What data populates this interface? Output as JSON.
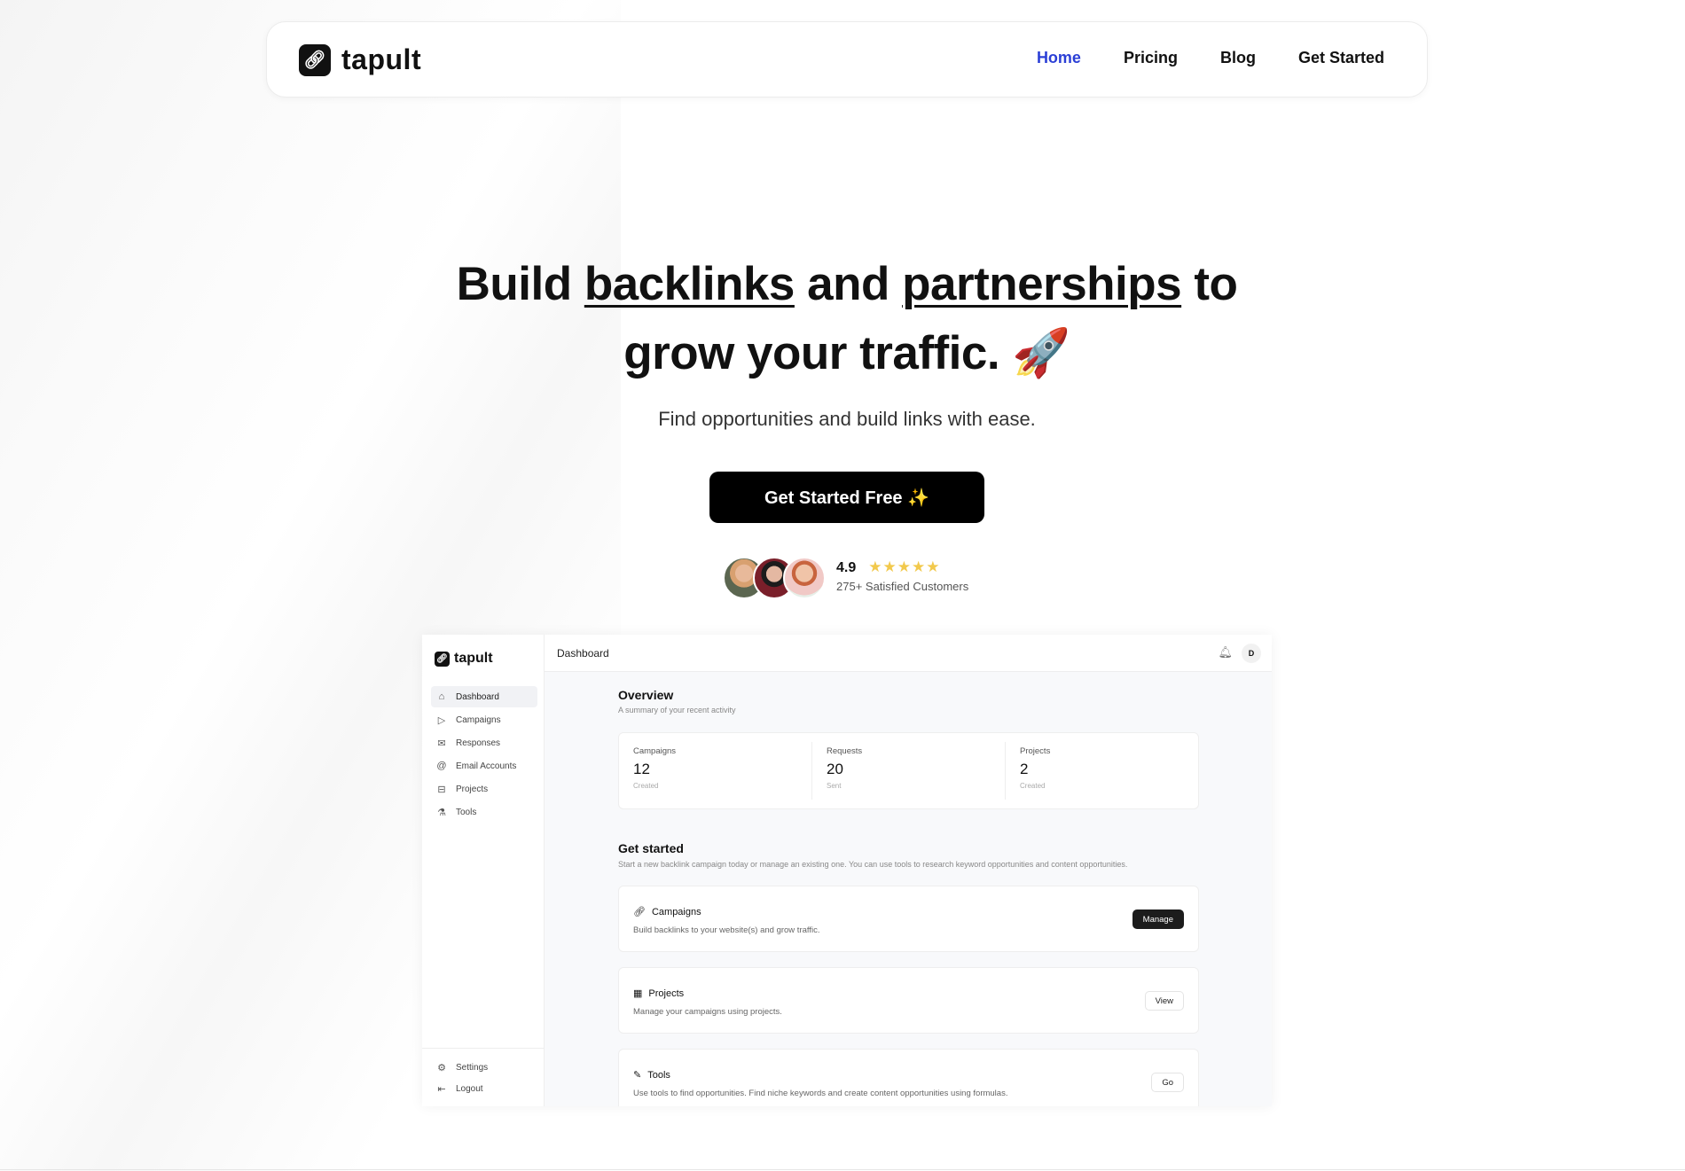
{
  "nav": {
    "brand": "tapult",
    "links": [
      {
        "label": "Home",
        "active": true
      },
      {
        "label": "Pricing"
      },
      {
        "label": "Blog"
      },
      {
        "label": "Get Started"
      }
    ],
    "active_color": "#2b3fd6"
  },
  "hero": {
    "line1_pre": "Build ",
    "word1": "backlinks",
    "line1_mid": " and ",
    "word2": "partnerships",
    "line1_post": " to",
    "line2": "grow your traffic. 🚀",
    "subtitle": "Find opportunities and build links with ease.",
    "cta": "Get Started Free ✨"
  },
  "social_proof": {
    "rating": "4.9",
    "stars": 5,
    "customers": "275+ Satisfied Customers",
    "star_color": "#f2c94c"
  },
  "dashboard": {
    "brand": "tapult",
    "header_title": "Dashboard",
    "avatar_letter": "D",
    "sidebar": [
      {
        "label": "Dashboard",
        "icon": "home-icon",
        "active": true
      },
      {
        "label": "Campaigns",
        "icon": "send-icon"
      },
      {
        "label": "Responses",
        "icon": "mail-icon"
      },
      {
        "label": "Email Accounts",
        "icon": "at-icon"
      },
      {
        "label": "Projects",
        "icon": "briefcase-icon"
      },
      {
        "label": "Tools",
        "icon": "flask-icon"
      }
    ],
    "sidebar_bottom": [
      {
        "label": "Settings",
        "icon": "gear-icon"
      },
      {
        "label": "Logout",
        "icon": "logout-icon"
      }
    ],
    "overview": {
      "title": "Overview",
      "subtitle": "A summary of your recent activity",
      "stats": [
        {
          "label": "Campaigns",
          "value": "12",
          "sub": "Created"
        },
        {
          "label": "Requests",
          "value": "20",
          "sub": "Sent"
        },
        {
          "label": "Projects",
          "value": "2",
          "sub": "Created"
        }
      ]
    },
    "get_started": {
      "title": "Get started",
      "subtitle": "Start a new backlink campaign today or manage an existing one. You can use tools to research keyword opportunities and content opportunities.",
      "cards": [
        {
          "title": "Campaigns",
          "desc": "Build backlinks to your website(s) and grow traffic.",
          "button": "Manage"
        },
        {
          "title": "Projects",
          "desc": "Manage your campaigns using projects.",
          "button": "View"
        },
        {
          "title": "Tools",
          "desc": "Use tools to find opportunities. Find niche keywords and create content opportunities using formulas.",
          "button": "Go"
        }
      ]
    }
  }
}
